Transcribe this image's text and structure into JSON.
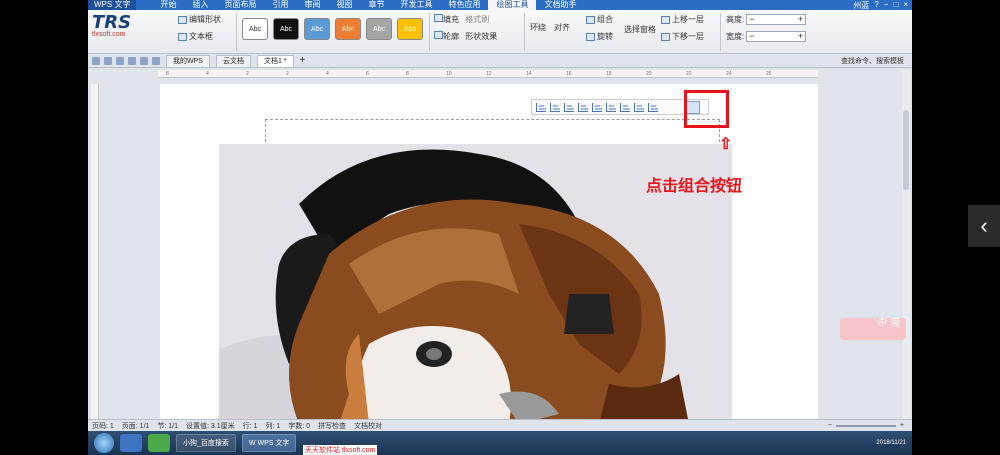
{
  "titlebar": {
    "app_button": "WPS 文字",
    "menu": [
      "开始",
      "插入",
      "页面布局",
      "引用",
      "审阅",
      "视图",
      "章节",
      "开发工具",
      "特色应用",
      "绘图工具",
      "文档助手"
    ],
    "active_menu": "绘图工具",
    "user": "州蓝",
    "controls": [
      "?",
      "−",
      "□",
      "×"
    ]
  },
  "logo": {
    "main": "TRS",
    "sub": "tlxsoft.com"
  },
  "ribbon": {
    "edit_shape": "编辑形状",
    "text_box": "文本框",
    "style_label": "Abc",
    "fill": "填充",
    "format_painter": "格式刷",
    "outline": "轮廓",
    "shape_effects": "形状效果",
    "wrap": "环绕",
    "align": "对齐",
    "group": "组合",
    "rotate": "旋转",
    "select_pane": "选择窗格",
    "bring_forward": "上移一层",
    "send_backward": "下移一层",
    "height": "高度:",
    "width": "宽度:"
  },
  "tabs": {
    "my_wps": "我的WPS",
    "cloud_docs": "云文档",
    "doc1": "文档1 *",
    "new_tab": "+",
    "search": "查找命令、搜索模板"
  },
  "annotation": {
    "arrow": "⇧",
    "callout": "点击组合按钮"
  },
  "ime": {
    "text": "中 简"
  },
  "statusbar": {
    "page_code": "页码: 1",
    "page": "页面: 1/1",
    "section": "节: 1/1",
    "setting": "设置值: 3.1厘米",
    "row": "行: 1",
    "col": "列: 1",
    "words": "字数: 0",
    "spell": "拼写检查",
    "proof": "文档校对"
  },
  "taskbar": {
    "item1": "小狗_百度搜索",
    "item2": "W  WPS 文字",
    "watermark": "天天软件站  tlxsoft.com",
    "clock": "2018/11/21"
  },
  "colors": {
    "accent": "#2b6cc4",
    "annotation_red": "#e5151b"
  }
}
